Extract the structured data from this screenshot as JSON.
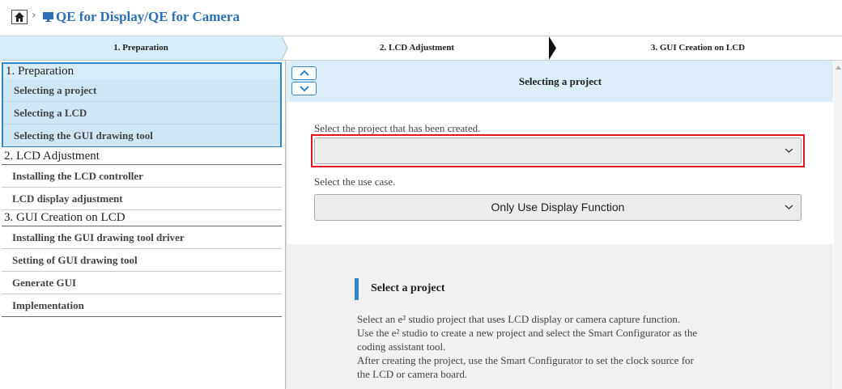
{
  "breadcrumb": {
    "separator": "›",
    "app_title": "QE for Display/QE for Camera",
    "home_icon": "home-icon",
    "monitor_icon": "monitor-icon"
  },
  "steps": [
    {
      "label": "1. Preparation",
      "active": true
    },
    {
      "label": "2. LCD Adjustment",
      "active": false
    },
    {
      "label": "3. GUI Creation on LCD",
      "active": false
    }
  ],
  "sidebar": {
    "sections": [
      {
        "title": "1. Preparation",
        "items": [
          "Selecting a project",
          "Selecting a LCD",
          "Selecting the GUI drawing tool"
        ]
      },
      {
        "title": "2. LCD Adjustment",
        "items": [
          "Installing the LCD controller",
          "LCD display adjustment"
        ]
      },
      {
        "title": "3. GUI Creation on LCD",
        "items": [
          "Installing the GUI drawing tool driver",
          "Setting of GUI drawing tool",
          "Generate GUI",
          "Implementation"
        ]
      }
    ]
  },
  "main": {
    "title": "Selecting a project",
    "project_label": "Select the project that has been created.",
    "project_value": "",
    "usecase_label": "Select the use case.",
    "usecase_value": "Only Use Display Function",
    "info": {
      "title": "Select a project",
      "lines": [
        "Select an e² studio project that uses LCD display or camera capture function.",
        "Use the e² studio to create a new project and select the Smart Configurator as the",
        "coding assistant tool.",
        "After creating the project, use the Smart Configurator to set the clock source for",
        "the LCD or camera board."
      ]
    }
  },
  "colors": {
    "accent": "#2f86c9",
    "title_blue": "#2d6fb6",
    "highlight_red": "#e0161e",
    "active_bg": "#d8ecf8"
  }
}
